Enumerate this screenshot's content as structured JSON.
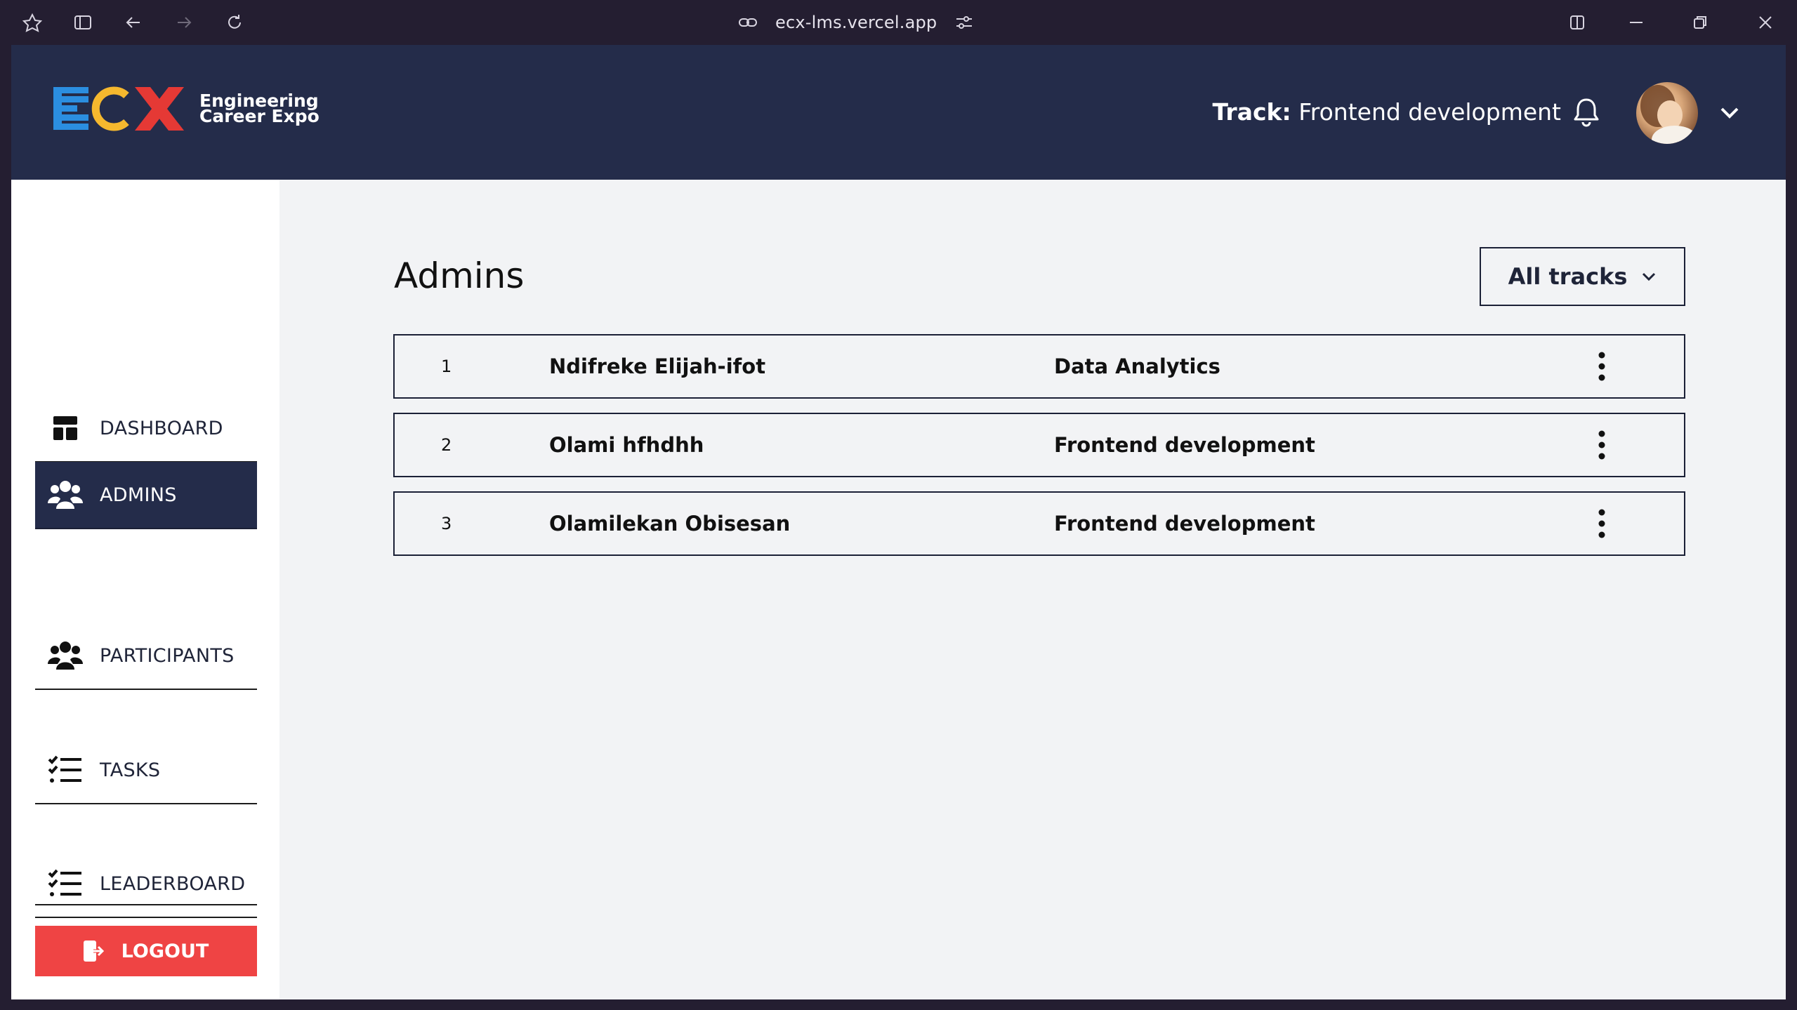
{
  "browser": {
    "url": "ecx-lms.vercel.app"
  },
  "header": {
    "logo_text": "ECX",
    "logo_sub_line1": "Engineering",
    "logo_sub_line2": "Career Expo",
    "track_label": "Track:",
    "track_value": "Frontend development"
  },
  "sidebar": {
    "items": [
      {
        "label": "DASHBOARD",
        "icon": "dashboard-icon",
        "active": false
      },
      {
        "label": "ADMINS",
        "icon": "users-icon",
        "active": true
      },
      {
        "label": "PARTICIPANTS",
        "icon": "users-icon",
        "active": false
      },
      {
        "label": "TASKS",
        "icon": "checklist-icon",
        "active": false
      },
      {
        "label": "LEADERBOARD",
        "icon": "checklist-icon",
        "active": false
      }
    ],
    "logout_label": "LOGOUT"
  },
  "main": {
    "title": "Admins",
    "filter_label": "All tracks",
    "rows": [
      {
        "num": "1",
        "name": "Ndifreke Elijah-ifot",
        "track": "Data Analytics"
      },
      {
        "num": "2",
        "name": "Olami hfhdhh",
        "track": "Frontend development"
      },
      {
        "num": "3",
        "name": "Olamilekan Obisesan",
        "track": "Frontend development"
      }
    ]
  },
  "colors": {
    "header_bg": "#242c4a",
    "active_nav_bg": "#242c4a",
    "logout_bg": "#ef4444",
    "browser_bg": "#241e31",
    "logo_blue": "#2b8ee0",
    "logo_yellow": "#f5b82e",
    "logo_red": "#e53935"
  }
}
